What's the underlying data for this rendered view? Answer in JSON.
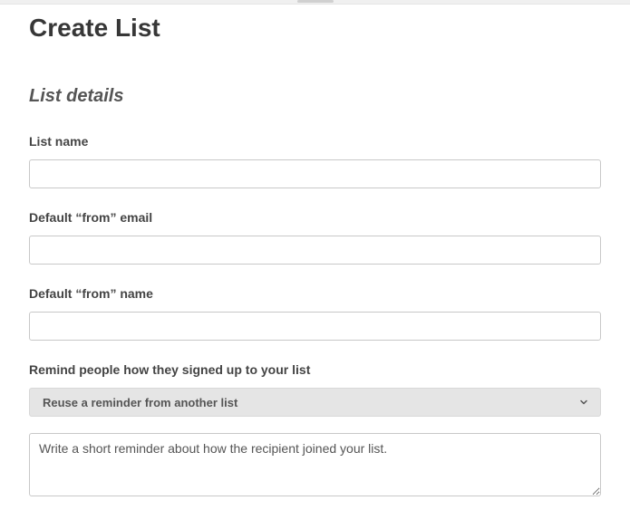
{
  "page": {
    "title": "Create List"
  },
  "section": {
    "title": "List details"
  },
  "fields": {
    "list_name": {
      "label": "List name",
      "value": ""
    },
    "from_email": {
      "label": "Default “from” email",
      "value": ""
    },
    "from_name": {
      "label": "Default “from” name",
      "value": ""
    },
    "reminder": {
      "label": "Remind people how they signed up to your list",
      "dropdown_selected": "Reuse a reminder from another list",
      "textarea_placeholder": "Write a short reminder about how the recipient joined your list.",
      "textarea_value": ""
    }
  }
}
